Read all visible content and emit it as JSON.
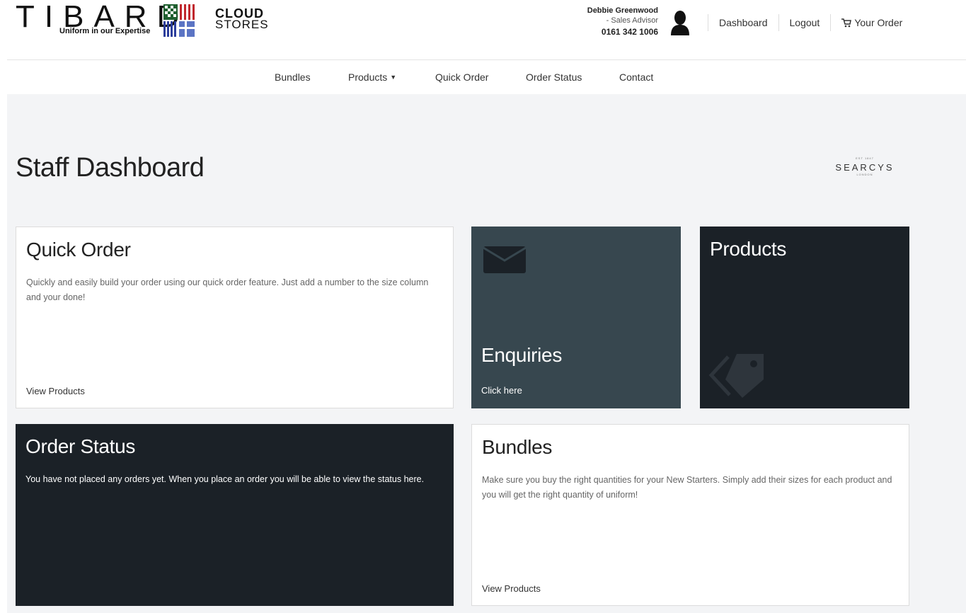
{
  "header": {
    "brand_word": "TIBARD",
    "brand_tagline": "Uniform in our Expertise",
    "cloud_line1": "CLOUD",
    "cloud_line2": "STORES",
    "user_name": "Debbie Greenwood",
    "user_role": "- Sales Advisor",
    "user_phone": "0161 342 1006",
    "links": {
      "dashboard": "Dashboard",
      "logout": "Logout",
      "order": "Your Order"
    }
  },
  "nav": {
    "bundles": "Bundles",
    "products": "Products",
    "quick_order": "Quick Order",
    "order_status": "Order Status",
    "contact": "Contact"
  },
  "page": {
    "title": "Staff Dashboard",
    "client_logo_small": "EST 1847",
    "client_logo": "SEARCYS",
    "client_logo_sub": "LONDON"
  },
  "cards": {
    "quick_order": {
      "title": "Quick Order",
      "desc": "Quickly and easily build your order using our quick order feature. Just add a number to the size column and your done!",
      "link": "View Products"
    },
    "enquiries": {
      "title": "Enquiries",
      "link": "Click here",
      "icon": "envelope-icon"
    },
    "products": {
      "title": "Products",
      "icon": "tag-icon"
    },
    "order_status": {
      "title": "Order Status",
      "desc": "You have not placed any orders yet. When you place an order you will be able to view the status here."
    },
    "bundles": {
      "title": "Bundles",
      "desc": "Make sure you buy the right quantities for your New Starters. Simply add their sizes for each product and you will get the right quantity of uniform!",
      "link": "View Products"
    }
  },
  "colors": {
    "teal_card": "#37474f",
    "dark_card": "#1b2127",
    "background": "#f3f4f6"
  }
}
